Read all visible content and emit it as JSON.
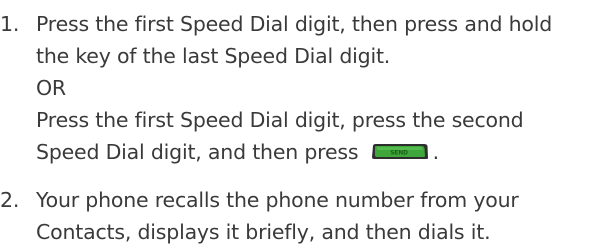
{
  "steps": [
    {
      "number": "1.",
      "line1": "Press the first Speed Dial digit, then press and hold",
      "line2": "the key of the last Speed Dial digit.",
      "separator": "OR",
      "line3": "Press the first Speed Dial digit, press the second",
      "line4_before_key": "Speed Dial digit, and then press",
      "line4_after_key": ".",
      "key_label": "SEND"
    },
    {
      "number": "2.",
      "line1": "Your phone recalls the phone number from your",
      "line2": "Contacts, displays it briefly, and then dials it."
    }
  ],
  "colors": {
    "text": "#3a3a3a",
    "send_key_dark": "#2e2e2e",
    "send_key_green": "#3ea63a"
  },
  "icons": {
    "send_key": "send-key-icon"
  }
}
